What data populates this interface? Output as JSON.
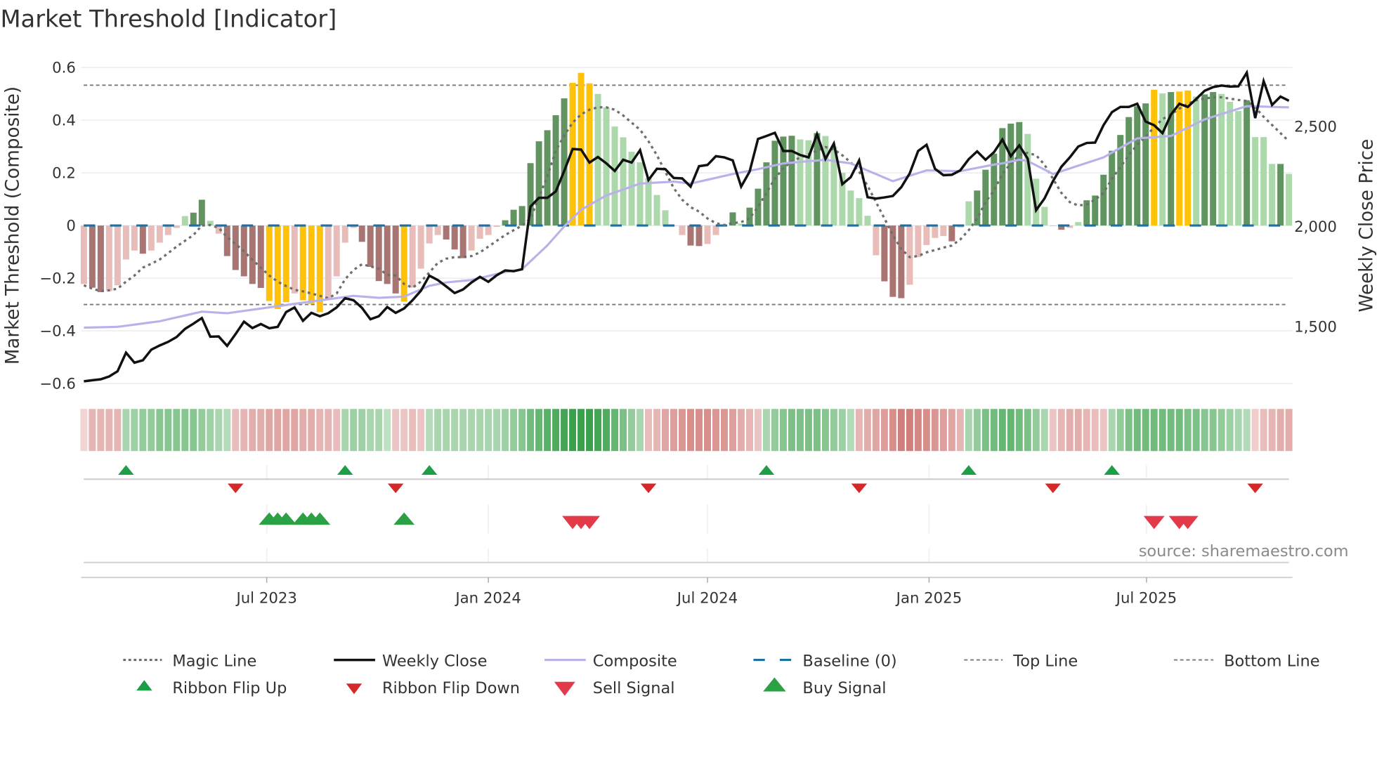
{
  "chart_data": {
    "type": "bar",
    "title": "Market Threshold [Indicator]",
    "ylabel_left": "Market Threshold (Composite)",
    "ylabel_right": "Weekly Close Price",
    "frequency": "weekly",
    "bar_count": 144,
    "ylim_left": [
      -0.65,
      0.65
    ],
    "yticks_left": [
      {
        "v": 0.6,
        "label": "0.6"
      },
      {
        "v": 0.4,
        "label": "0.4"
      },
      {
        "v": 0.2,
        "label": "0.2"
      },
      {
        "v": 0,
        "label": "0"
      },
      {
        "v": -0.2,
        "label": "−0.2"
      },
      {
        "v": -0.4,
        "label": "−0.4"
      },
      {
        "v": -0.6,
        "label": "−0.6"
      }
    ],
    "yticks_right": [
      {
        "v": 2500,
        "label": "2,500"
      },
      {
        "v": 2000,
        "label": "2,000"
      },
      {
        "v": 1500,
        "label": "1,500"
      }
    ],
    "xticks": [
      {
        "week": 21.7,
        "label": "Jul 2023"
      },
      {
        "week": 48,
        "label": "Jan 2024"
      },
      {
        "week": 74,
        "label": "Jul 2024"
      },
      {
        "week": 100.3,
        "label": "Jan 2025"
      },
      {
        "week": 126.1,
        "label": "Jul 2025"
      }
    ],
    "top_line": 0.533,
    "bottom_line": -0.3,
    "baseline": 0,
    "composite_bars": [
      -0.222,
      -0.236,
      -0.253,
      -0.249,
      -0.227,
      -0.129,
      -0.095,
      -0.107,
      -0.095,
      -0.065,
      -0.036,
      -0.009,
      0.036,
      0.049,
      0.098,
      0.018,
      -0.031,
      -0.116,
      -0.169,
      -0.193,
      -0.222,
      -0.237,
      -0.287,
      -0.317,
      -0.291,
      -0.258,
      -0.284,
      -0.298,
      -0.329,
      -0.276,
      -0.193,
      -0.065,
      -0.009,
      -0.062,
      -0.157,
      -0.211,
      -0.222,
      -0.258,
      -0.289,
      -0.236,
      -0.164,
      -0.068,
      -0.036,
      -0.053,
      -0.091,
      -0.124,
      -0.095,
      -0.05,
      -0.036,
      -0.005,
      0.02,
      0.06,
      0.074,
      0.237,
      0.32,
      0.362,
      0.419,
      0.483,
      0.542,
      0.58,
      0.54,
      0.5,
      0.449,
      0.376,
      0.335,
      0.28,
      0.24,
      0.18,
      0.116,
      0.058,
      0,
      -0.036,
      -0.076,
      -0.078,
      -0.07,
      -0.036,
      0,
      0.05,
      0.007,
      0.068,
      0.14,
      0.24,
      0.322,
      0.338,
      0.341,
      0.327,
      0.324,
      0.351,
      0.34,
      0.3,
      0.2,
      0.133,
      0.104,
      0.037,
      -0.113,
      -0.212,
      -0.271,
      -0.276,
      -0.225,
      -0.12,
      -0.074,
      -0.047,
      -0.04,
      -0.06,
      -0.007,
      0.092,
      0.133,
      0.212,
      0.273,
      0.37,
      0.387,
      0.393,
      0.348,
      0.178,
      0.071,
      0,
      -0.016,
      -0.009,
      0.013,
      0.096,
      0.114,
      0.193,
      0.284,
      0.344,
      0.412,
      0.453,
      0.464,
      0.516,
      0.502,
      0.507,
      0.509,
      0.513,
      0.49,
      0.498,
      0.507,
      0.5,
      0.47,
      0.435,
      0.476,
      0.336,
      0.336,
      0.234,
      0.234,
      0.196
    ],
    "bar_states": [
      "lr",
      "dr",
      "dr",
      "lr",
      "lr",
      "lr",
      "lr",
      "dr",
      "lr",
      "lr",
      "lr",
      "lr",
      "lg",
      "dg",
      "dg",
      "lg",
      "lr",
      "dr",
      "dr",
      "dr",
      "dr",
      "dr",
      "y",
      "y",
      "y",
      "lr",
      "y",
      "y",
      "y",
      "lr",
      "lr",
      "lr",
      "lr",
      "dr",
      "dr",
      "dr",
      "dr",
      "dr",
      "y",
      "lr",
      "lr",
      "lr",
      "lr",
      "dr",
      "dr",
      "dr",
      "lr",
      "lr",
      "lr",
      "lr",
      "dg",
      "dg",
      "dg",
      "dg",
      "dg",
      "dg",
      "dg",
      "dg",
      "y",
      "y",
      "y",
      "lg",
      "lg",
      "lg",
      "lg",
      "lg",
      "lg",
      "lg",
      "lg",
      "lg",
      "lg",
      "lr",
      "dr",
      "dr",
      "lr",
      "lr",
      "lr",
      "dg",
      "lg",
      "dg",
      "dg",
      "dg",
      "dg",
      "dg",
      "dg",
      "lg",
      "lg",
      "dg",
      "lg",
      "lg",
      "lg",
      "lg",
      "lg",
      "lg",
      "lr",
      "dr",
      "dr",
      "dr",
      "lr",
      "lr",
      "lr",
      "lr",
      "lr",
      "dr",
      "lr",
      "lg",
      "dg",
      "dg",
      "dg",
      "dg",
      "dg",
      "dg",
      "lg",
      "lg",
      "lg",
      "lg",
      "dr",
      "lr",
      "lg",
      "dg",
      "dg",
      "dg",
      "dg",
      "dg",
      "dg",
      "dg",
      "dg",
      "y",
      "lg",
      "dg",
      "y",
      "y",
      "lg",
      "dg",
      "dg",
      "lg",
      "lg",
      "lg",
      "dg",
      "lg",
      "lg",
      "lg",
      "dg",
      "lg"
    ],
    "bar_state_colors": {
      "dg": "#629462",
      "lg": "#acd8ac",
      "dr": "#a97572",
      "lr": "#e8bcb8",
      "y": "#ffc20a"
    },
    "magic_line": [
      -0.227,
      -0.24,
      -0.249,
      -0.246,
      -0.24,
      -0.213,
      -0.19,
      -0.16,
      -0.145,
      -0.129,
      -0.105,
      -0.08,
      -0.058,
      -0.036,
      0,
      0.002,
      -0.009,
      -0.044,
      -0.07,
      -0.098,
      -0.13,
      -0.16,
      -0.19,
      -0.213,
      -0.23,
      -0.244,
      -0.25,
      -0.258,
      -0.267,
      -0.276,
      -0.258,
      -0.204,
      -0.169,
      -0.147,
      -0.155,
      -0.164,
      -0.187,
      -0.19,
      -0.222,
      -0.236,
      -0.213,
      -0.178,
      -0.142,
      -0.126,
      -0.12,
      -0.12,
      -0.116,
      -0.102,
      -0.08,
      -0.058,
      -0.036,
      -0.018,
      0,
      0.027,
      0.107,
      0.187,
      0.284,
      0.342,
      0.391,
      0.422,
      0.44,
      0.449,
      0.449,
      0.44,
      0.418,
      0.391,
      0.364,
      0.32,
      0.267,
      0.204,
      0.142,
      0.098,
      0.07,
      0.053,
      0.027,
      0.009,
      0.002,
      0.009,
      0.013,
      0.027,
      0.071,
      0.124,
      0.178,
      0.218,
      0.244,
      0.258,
      0.271,
      0.284,
      0.298,
      0.289,
      0.267,
      0.24,
      0.204,
      0.151,
      0.089,
      0.027,
      -0.036,
      -0.089,
      -0.12,
      -0.116,
      -0.102,
      -0.093,
      -0.084,
      -0.076,
      -0.053,
      -0.018,
      0.027,
      0.089,
      0.133,
      0.196,
      0.236,
      0.267,
      0.276,
      0.267,
      0.231,
      0.178,
      0.124,
      0.089,
      0.076,
      0.08,
      0.098,
      0.124,
      0.178,
      0.222,
      0.267,
      0.307,
      0.338,
      0.373,
      0.404,
      0.422,
      0.444,
      0.462,
      0.476,
      0.482,
      0.487,
      0.487,
      0.482,
      0.477,
      0.473,
      0.449,
      0.413,
      0.382,
      0.351,
      0.32
    ],
    "weekly_close": [
      1226,
      1231,
      1236,
      1250,
      1276,
      1369,
      1319,
      1331,
      1384,
      1405,
      1423,
      1447,
      1488,
      1514,
      1542,
      1449,
      1450,
      1403,
      1462,
      1524,
      1492,
      1512,
      1491,
      1498,
      1572,
      1595,
      1528,
      1568,
      1551,
      1566,
      1595,
      1641,
      1631,
      1593,
      1536,
      1551,
      1597,
      1568,
      1590,
      1631,
      1679,
      1754,
      1732,
      1700,
      1667,
      1685,
      1720,
      1748,
      1723,
      1756,
      1780,
      1776,
      1786,
      2099,
      2143,
      2143,
      2175,
      2277,
      2387,
      2384,
      2319,
      2347,
      2315,
      2277,
      2333,
      2319,
      2381,
      2232,
      2288,
      2286,
      2242,
      2240,
      2199,
      2301,
      2307,
      2351,
      2345,
      2330,
      2199,
      2274,
      2437,
      2452,
      2468,
      2377,
      2377,
      2357,
      2345,
      2461,
      2337,
      2414,
      2211,
      2246,
      2330,
      2146,
      2139,
      2145,
      2152,
      2196,
      2265,
      2377,
      2408,
      2288,
      2256,
      2258,
      2280,
      2336,
      2375,
      2333,
      2371,
      2434,
      2351,
      2405,
      2339,
      2081,
      2140,
      2226,
      2298,
      2345,
      2399,
      2417,
      2419,
      2506,
      2571,
      2597,
      2597,
      2613,
      2524,
      2506,
      2466,
      2559,
      2613,
      2597,
      2637,
      2678,
      2696,
      2704,
      2699,
      2700,
      2768,
      2541,
      2726,
      2607,
      2649,
      2628
    ],
    "composite_line_keypoints": [
      [
        0,
        1494
      ],
      [
        4,
        1498
      ],
      [
        9,
        1526
      ],
      [
        14,
        1574
      ],
      [
        17,
        1566
      ],
      [
        25,
        1613
      ],
      [
        32,
        1653
      ],
      [
        35,
        1643
      ],
      [
        38,
        1649
      ],
      [
        41,
        1703
      ],
      [
        43,
        1720
      ],
      [
        46,
        1732
      ],
      [
        50,
        1772
      ],
      [
        52,
        1786
      ],
      [
        55,
        1905
      ],
      [
        57,
        2000
      ],
      [
        59,
        2083
      ],
      [
        62,
        2155
      ],
      [
        66,
        2214
      ],
      [
        70,
        2224
      ],
      [
        72,
        2214
      ],
      [
        77,
        2262
      ],
      [
        80,
        2286
      ],
      [
        83,
        2315
      ],
      [
        88,
        2333
      ],
      [
        91,
        2315
      ],
      [
        96,
        2226
      ],
      [
        100,
        2280
      ],
      [
        104,
        2276
      ],
      [
        108,
        2309
      ],
      [
        109,
        2315
      ],
      [
        111,
        2333
      ],
      [
        112,
        2327
      ],
      [
        115,
        2262
      ],
      [
        121,
        2345
      ],
      [
        125,
        2440
      ],
      [
        129,
        2452
      ],
      [
        133,
        2535
      ],
      [
        138,
        2601
      ],
      [
        143,
        2595
      ]
    ],
    "ribbon": [
      -0.1,
      -0.3,
      -0.3,
      -0.3,
      -0.3,
      0.3,
      0.35,
      0.4,
      0.4,
      0.45,
      0.45,
      0.45,
      0.45,
      0.45,
      0.4,
      0.35,
      0.3,
      0.25,
      -0.25,
      -0.3,
      -0.35,
      -0.35,
      -0.4,
      -0.4,
      -0.4,
      -0.4,
      -0.35,
      -0.35,
      -0.3,
      -0.3,
      -0.25,
      0.3,
      0.35,
      0.35,
      0.3,
      0.3,
      0.2,
      -0.2,
      -0.2,
      -0.25,
      -0.2,
      0.25,
      0.3,
      0.3,
      0.3,
      0.3,
      0.3,
      0.3,
      0.3,
      0.3,
      0.35,
      0.4,
      0.45,
      0.55,
      0.6,
      0.65,
      0.7,
      0.75,
      0.8,
      0.8,
      0.8,
      0.75,
      0.7,
      0.6,
      0.5,
      0.4,
      0.3,
      -0.25,
      -0.3,
      -0.4,
      -0.45,
      -0.5,
      -0.55,
      -0.55,
      -0.55,
      -0.5,
      -0.5,
      -0.45,
      -0.35,
      -0.3,
      -0.2,
      0.3,
      0.4,
      0.45,
      0.5,
      0.5,
      0.5,
      0.5,
      0.45,
      0.4,
      0.35,
      0.25,
      -0.3,
      -0.35,
      -0.4,
      -0.45,
      -0.55,
      -0.65,
      -0.65,
      -0.6,
      -0.55,
      -0.5,
      -0.45,
      -0.4,
      -0.3,
      0.3,
      0.4,
      0.5,
      0.55,
      0.6,
      0.6,
      0.55,
      0.5,
      0.4,
      0.3,
      -0.2,
      -0.3,
      -0.35,
      -0.35,
      -0.3,
      -0.25,
      -0.2,
      0.3,
      0.4,
      0.5,
      0.55,
      0.55,
      0.55,
      0.55,
      0.55,
      0.55,
      0.5,
      0.5,
      0.45,
      0.45,
      0.4,
      0.35,
      0.3,
      0.25,
      -0.15,
      -0.25,
      -0.3,
      -0.35,
      -0.35
    ],
    "ribbon_flip_up_weeks": [
      5,
      31,
      41,
      81,
      105,
      122
    ],
    "ribbon_flip_down_weeks": [
      18,
      37,
      67,
      92,
      115,
      139
    ],
    "buy_signal_weeks": [
      22,
      23,
      24,
      26,
      27,
      28,
      38
    ],
    "sell_signal_weeks": [
      58,
      59,
      60,
      127,
      130,
      131
    ],
    "colors": {
      "magic": "#6e6e6e",
      "close": "#111111",
      "composite": "#b9b1ea",
      "baseline": "#1f6f9f",
      "thresholds": "#777777",
      "flip_up": "#1e9e48",
      "flip_down": "#d62828",
      "buy": "#2ca044",
      "sell": "#e23a48"
    },
    "legend": [
      {
        "label": "Magic Line",
        "kind": "dotted"
      },
      {
        "label": "Weekly Close",
        "kind": "solid-black"
      },
      {
        "label": "Composite",
        "kind": "solid-purple"
      },
      {
        "label": "Baseline (0)",
        "kind": "dashed-blue"
      },
      {
        "label": "Top Line",
        "kind": "thin-dashed"
      },
      {
        "label": "Bottom Line",
        "kind": "thin-dashed"
      },
      {
        "label": "Ribbon Flip Up",
        "kind": "tri-up-small"
      },
      {
        "label": "Ribbon Flip Down",
        "kind": "tri-down-small"
      },
      {
        "label": "Sell Signal",
        "kind": "tri-down-large"
      },
      {
        "label": "Buy Signal",
        "kind": "tri-up-large"
      }
    ],
    "legend_placement": "bottom",
    "source": "source: sharemaestro.com"
  }
}
